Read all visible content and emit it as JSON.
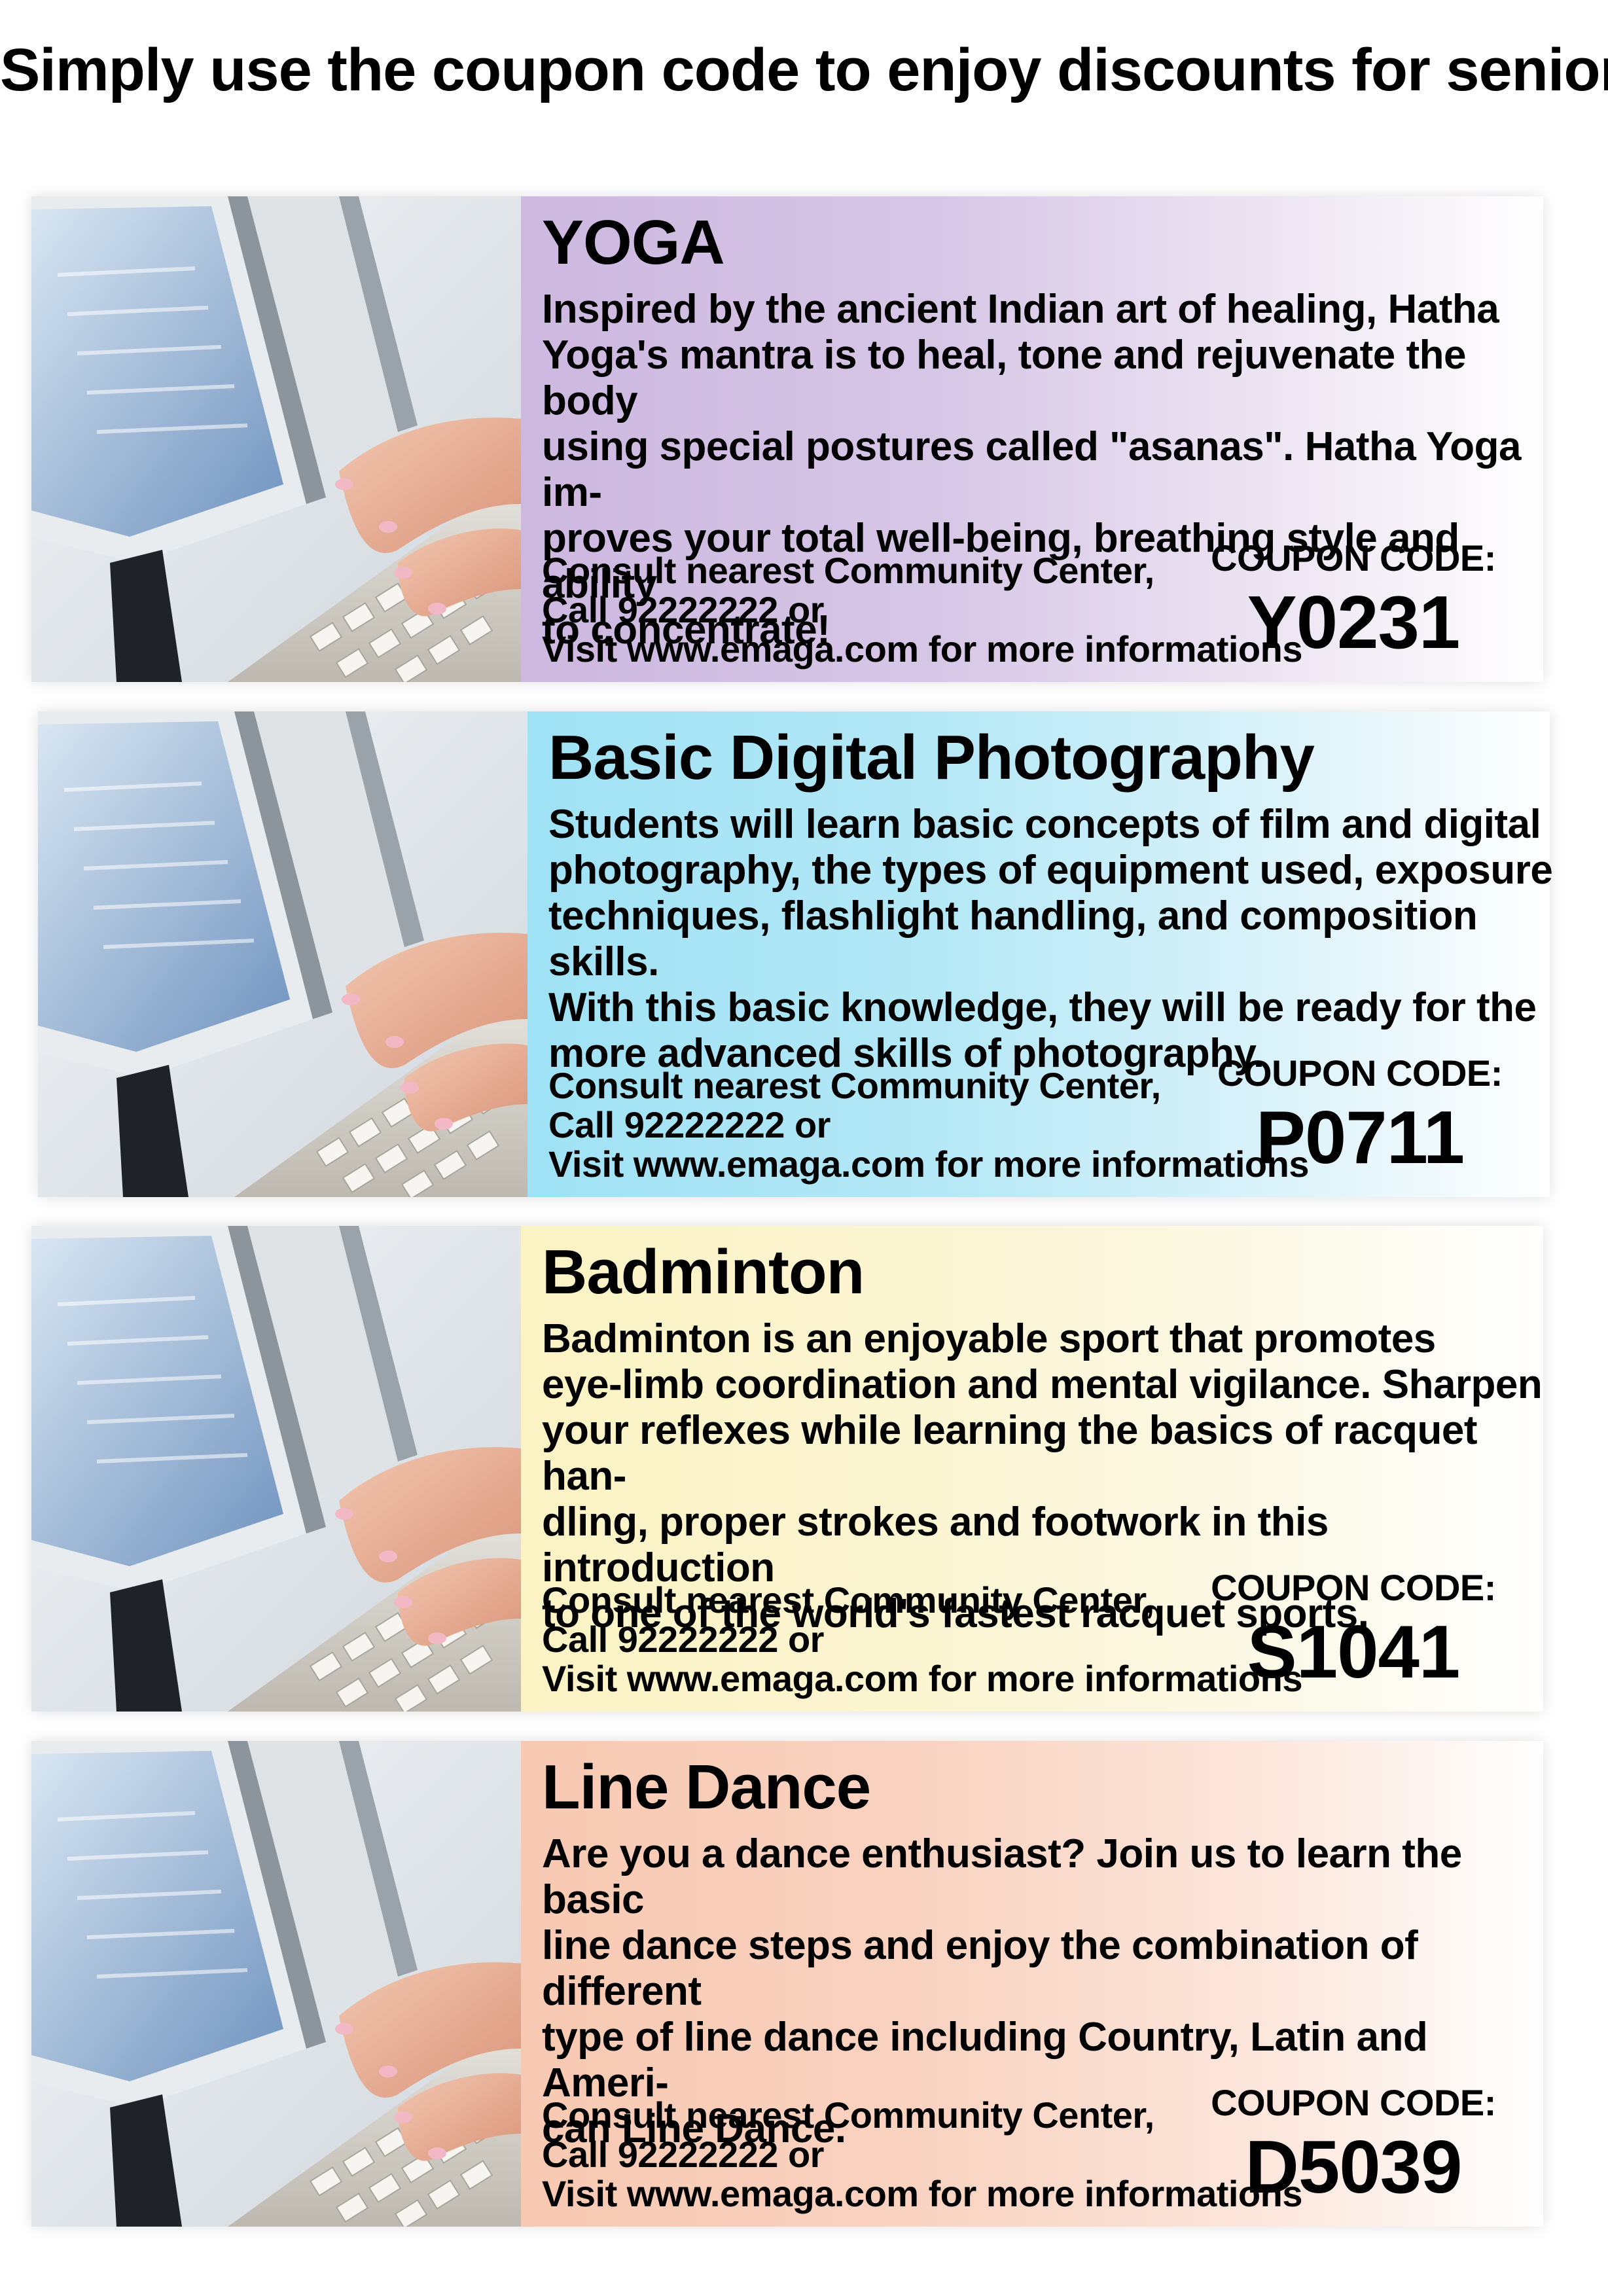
{
  "header": {
    "title": "Simply use the coupon code to enjoy discounts for seniors"
  },
  "cards": [
    {
      "title": "YOGA",
      "description": "Inspired by the ancient Indian art of healing, Hatha\nYoga's mantra is to heal, tone and rejuvenate the body\nusing special postures called \"asanas\". Hatha Yoga im-\nproves your total well-being, breathing style and ability\nto concentrate!",
      "consult": "Consult nearest Community Center,\nCall 92222222 or\nVisit www.emaga.com for more informations",
      "coupon_label": "COUPON CODE:",
      "coupon_code": "Y0231"
    },
    {
      "title": "Basic Digital Photography",
      "description": "Students will learn basic concepts of film and digital\nphotography, the types of equipment used, exposure\ntechniques, flashlight handling, and composition skills.\nWith this basic knowledge, they will be ready for the\nmore advanced skills of photography.",
      "consult": "Consult nearest Community Center,\nCall 92222222 or\nVisit www.emaga.com for more informations",
      "coupon_label": "COUPON CODE:",
      "coupon_code": "P0711"
    },
    {
      "title": "Badminton",
      "description": "Badminton is an enjoyable sport that promotes\neye-limb coordination and mental vigilance. Sharpen\nyour reflexes while learning the basics of racquet han-\ndling, proper strokes and footwork in this introduction\nto one of the world's fastest racquet sports.",
      "consult": "Consult nearest Community Center,\nCall 92222222 or\nVisit www.emaga.com for more informations",
      "coupon_label": "COUPON CODE:",
      "coupon_code": "S1041"
    },
    {
      "title": "Line Dance",
      "description": "Are you a dance enthusiast? Join us to learn the basic\nline dance steps and enjoy the combination of different\ntype of line dance including Country, Latin and Ameri-\ncan Line Dance.",
      "consult": "Consult nearest Community Center,\nCall 92222222 or\nVisit www.emaga.com for more informations",
      "coupon_label": "COUPON CODE:",
      "coupon_code": "D5039"
    }
  ],
  "colors": {
    "yoga_panel": "#cdb8e0",
    "photography_panel": "#9fe2f5",
    "badminton_panel": "#fbf3c4",
    "line_dance_panel": "#f8c9b2"
  },
  "image": {
    "subject": "hands-typing-on-keyboard-photo"
  }
}
